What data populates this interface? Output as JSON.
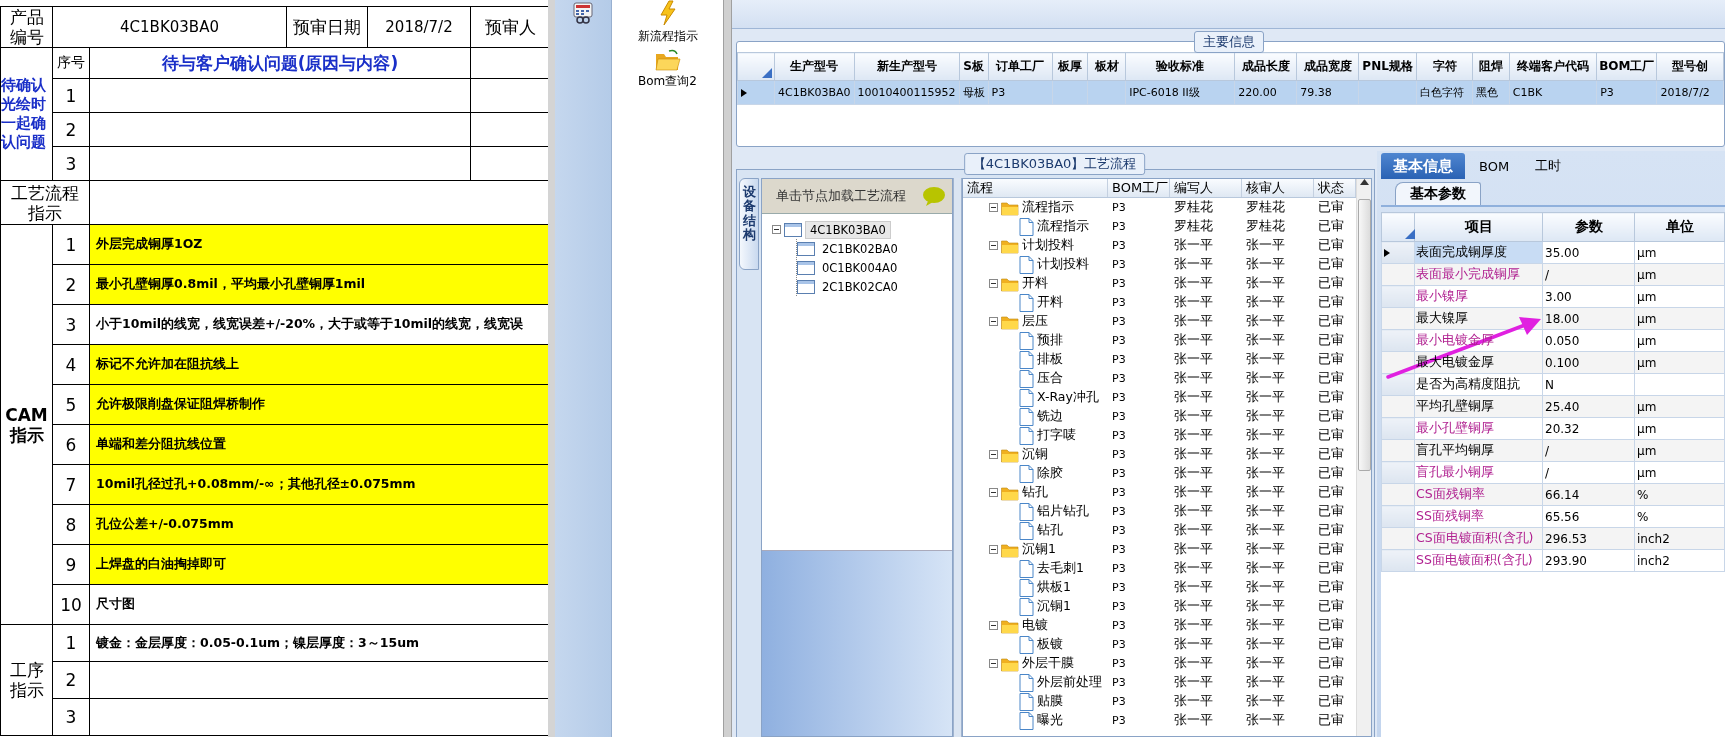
{
  "document": {
    "header": {
      "product_label": "产品编号",
      "product_no": "4C1BK03BA0",
      "date_label": "预审日期",
      "date": "2018/7/2",
      "reviewer_label": "预审人"
    },
    "confirm": {
      "label": "待确认光绘时一起确认问题",
      "seq_header": "序号",
      "question_header": "待与客户确认问题(原因与内容)",
      "rows": [
        "1",
        "2",
        "3"
      ]
    },
    "flow": {
      "label": "工艺流程指示"
    },
    "cam": {
      "label": "CAM指示",
      "rows": [
        {
          "no": "1",
          "text": "外层完成铜厚1OZ",
          "highlighted": true
        },
        {
          "no": "2",
          "text": "最小孔壁铜厚0.8mil，平均最小孔壁铜厚1mil",
          "highlighted": true
        },
        {
          "no": "3",
          "text": "小于10mil的线宽，线宽误差+/-20%，大于或等于10mil的线宽，线宽误",
          "highlighted": false
        },
        {
          "no": "4",
          "text": "标记不允许加在阻抗线上",
          "highlighted": true
        },
        {
          "no": "5",
          "text": "允许极限削盘保证阻焊桥制作",
          "highlighted": true
        },
        {
          "no": "6",
          "text": "单端和差分阻抗线位置",
          "highlighted": true
        },
        {
          "no": "7",
          "text": "10mil孔径过孔+0.08mm/-∞；其他孔径±0.075mm",
          "highlighted": true
        },
        {
          "no": "8",
          "text": "孔位公差+/-0.075mm",
          "highlighted": true
        },
        {
          "no": "9",
          "text": "上焊盘的白油掏掉即可",
          "highlighted": true
        },
        {
          "no": "10",
          "text": "尺寸图",
          "highlighted": false
        }
      ]
    },
    "process": {
      "label": "工序指示",
      "rows": [
        {
          "no": "1",
          "text": "镀金：金层厚度：0.05-0.1um；镍层厚度：3～15um"
        },
        {
          "no": "2"
        },
        {
          "no": "3"
        }
      ]
    }
  },
  "toolbar": {
    "buttons": [
      {
        "label": "新流程指示",
        "kind": "lightning"
      },
      {
        "label": "Bom查询2",
        "kind": "folder"
      }
    ]
  },
  "main_info": {
    "title": "主要信息",
    "columns": [
      "生产型号",
      "新生产型号",
      "S板",
      "订单工厂",
      "板厚",
      "板材",
      "验收标准",
      "成品长度",
      "成品宽度",
      "PNL规格",
      "字符",
      "阻焊",
      "终端客户代码",
      "BOM工厂",
      "型号创"
    ],
    "rows": [
      {
        "selected": true,
        "cells": [
          "4C1BK03BA0",
          "10010400115952",
          "母板",
          "P3",
          null,
          null,
          "IPC-6018 II级",
          "220.00",
          "79.38",
          null,
          "白色字符",
          "黑色",
          "C1BK",
          "P3",
          "2018/7/2"
        ]
      }
    ]
  },
  "process_flow": {
    "title": "【4C1BK03BA0】工艺流程",
    "side_tab": "设备结构",
    "tree_hint": "单击节点加载工艺流程",
    "tree": [
      {
        "name": "4C1BK03BA0",
        "selected": true,
        "children": [
          {
            "name": "2C1BK02BA0",
            "selected": false
          },
          {
            "name": "0C1BK004A0",
            "selected": false
          },
          {
            "name": "2C1BK02CA0",
            "selected": false
          }
        ]
      }
    ],
    "columns": [
      "流程",
      "BOM工厂",
      "编写人",
      "核审人",
      "状态"
    ],
    "steps": [
      {
        "name": "流程指示",
        "bom_factory": "P3",
        "writer": "罗桂花",
        "reviewer": "罗桂花",
        "status": "已审",
        "children": [
          {
            "name": "流程指示",
            "bom_factory": "P3",
            "writer": "罗桂花",
            "reviewer": "罗桂花",
            "status": "已审"
          }
        ]
      },
      {
        "name": "计划投料",
        "bom_factory": "P3",
        "writer": "张一平",
        "reviewer": "张一平",
        "status": "已审",
        "children": [
          {
            "name": "计划投料",
            "bom_factory": "P3",
            "writer": "张一平",
            "reviewer": "张一平",
            "status": "已审"
          }
        ]
      },
      {
        "name": "开料",
        "bom_factory": "P3",
        "writer": "张一平",
        "reviewer": "张一平",
        "status": "已审",
        "children": [
          {
            "name": "开料",
            "bom_factory": "P3",
            "writer": "张一平",
            "reviewer": "张一平",
            "status": "已审"
          }
        ]
      },
      {
        "name": "层压",
        "bom_factory": "P3",
        "writer": "张一平",
        "reviewer": "张一平",
        "status": "已审",
        "children": [
          {
            "name": "预排",
            "bom_factory": "P3",
            "writer": "张一平",
            "reviewer": "张一平",
            "status": "已审"
          },
          {
            "name": "排板",
            "bom_factory": "P3",
            "writer": "张一平",
            "reviewer": "张一平",
            "status": "已审"
          },
          {
            "name": "压合",
            "bom_factory": "P3",
            "writer": "张一平",
            "reviewer": "张一平",
            "status": "已审"
          },
          {
            "name": "X-Ray冲孔",
            "bom_factory": "P3",
            "writer": "张一平",
            "reviewer": "张一平",
            "status": "已审"
          },
          {
            "name": "铣边",
            "bom_factory": "P3",
            "writer": "张一平",
            "reviewer": "张一平",
            "status": "已审"
          },
          {
            "name": "打字唛",
            "bom_factory": "P3",
            "writer": "张一平",
            "reviewer": "张一平",
            "status": "已审"
          }
        ]
      },
      {
        "name": "沉铜",
        "bom_factory": "P3",
        "writer": "张一平",
        "reviewer": "张一平",
        "status": "已审",
        "children": [
          {
            "name": "除胶",
            "bom_factory": "P3",
            "writer": "张一平",
            "reviewer": "张一平",
            "status": "已审"
          }
        ]
      },
      {
        "name": "钻孔",
        "bom_factory": "P3",
        "writer": "张一平",
        "reviewer": "张一平",
        "status": "已审",
        "children": [
          {
            "name": "铝片钻孔",
            "bom_factory": "P3",
            "writer": "张一平",
            "reviewer": "张一平",
            "status": "已审"
          },
          {
            "name": "钻孔",
            "bom_factory": "P3",
            "writer": "张一平",
            "reviewer": "张一平",
            "status": "已审"
          }
        ]
      },
      {
        "name": "沉铜1",
        "bom_factory": "P3",
        "writer": "张一平",
        "reviewer": "张一平",
        "status": "已审",
        "children": [
          {
            "name": "去毛刺1",
            "bom_factory": "P3",
            "writer": "张一平",
            "reviewer": "张一平",
            "status": "已审"
          },
          {
            "name": "烘板1",
            "bom_factory": "P3",
            "writer": "张一平",
            "reviewer": "张一平",
            "status": "已审"
          },
          {
            "name": "沉铜1",
            "bom_factory": "P3",
            "writer": "张一平",
            "reviewer": "张一平",
            "status": "已审"
          }
        ]
      },
      {
        "name": "电镀",
        "bom_factory": "P3",
        "writer": "张一平",
        "reviewer": "张一平",
        "status": "已审",
        "children": [
          {
            "name": "板镀",
            "bom_factory": "P3",
            "writer": "张一平",
            "reviewer": "张一平",
            "status": "已审"
          }
        ]
      },
      {
        "name": "外层干膜",
        "bom_factory": "P3",
        "writer": "张一平",
        "reviewer": "张一平",
        "status": "已审",
        "children": [
          {
            "name": "外层前处理",
            "bom_factory": "P3",
            "writer": "张一平",
            "reviewer": "张一平",
            "status": "已审"
          },
          {
            "name": "贴膜",
            "bom_factory": "P3",
            "writer": "张一平",
            "reviewer": "张一平",
            "status": "已审"
          },
          {
            "name": "曝光",
            "bom_factory": "P3",
            "writer": "张一平",
            "reviewer": "张一平",
            "status": "已审"
          }
        ]
      }
    ]
  },
  "detail": {
    "tabs": [
      {
        "label": "基本信息",
        "selected": true
      },
      {
        "label": "BOM",
        "selected": false
      },
      {
        "label": "工时",
        "selected": false
      }
    ],
    "sub_tabs": [
      {
        "label": "基本参数",
        "selected": true
      }
    ],
    "columns": [
      "项目",
      "参数",
      "单位"
    ],
    "params": [
      {
        "item": "表面完成铜厚度",
        "value": "35.00",
        "unit": "μm",
        "highlighted": false,
        "selected": true
      },
      {
        "item": "表面最小完成铜厚",
        "value": "/",
        "unit": "μm",
        "highlighted": true,
        "selected": false
      },
      {
        "item": "最小镍厚",
        "value": "3.00",
        "unit": "μm",
        "highlighted": true,
        "selected": false
      },
      {
        "item": "最大镍厚",
        "value": "18.00",
        "unit": "μm",
        "highlighted": false,
        "selected": false
      },
      {
        "item": "最小电镀金厚",
        "value": "0.050",
        "unit": "μm",
        "highlighted": true,
        "selected": false
      },
      {
        "item": "最大电镀金厚",
        "value": "0.100",
        "unit": "μm",
        "highlighted": false,
        "selected": false
      },
      {
        "item": "是否为高精度阻抗",
        "value": "N",
        "highlighted": false,
        "selected": false
      },
      {
        "item": "平均孔壁铜厚",
        "value": "25.40",
        "unit": "μm",
        "highlighted": false,
        "selected": false
      },
      {
        "item": "最小孔壁铜厚",
        "value": "20.32",
        "unit": "μm",
        "highlighted": true,
        "selected": false
      },
      {
        "item": "盲孔平均铜厚",
        "value": "/",
        "unit": "μm",
        "highlighted": false,
        "selected": false
      },
      {
        "item": "盲孔最小铜厚",
        "value": "/",
        "unit": "μm",
        "highlighted": true,
        "selected": false
      },
      {
        "item": "CS面残铜率",
        "value": "66.14",
        "unit": "%",
        "highlighted": true,
        "selected": false
      },
      {
        "item": "SS面残铜率",
        "value": "65.56",
        "unit": "%",
        "highlighted": true,
        "selected": false
      },
      {
        "item": "CS面电镀面积(含孔)",
        "value": "296.53",
        "unit": "inch2",
        "highlighted": true,
        "selected": false
      },
      {
        "item": "SS面电镀面积(含孔)",
        "value": "293.90",
        "unit": "inch2",
        "highlighted": true,
        "selected": false
      }
    ]
  }
}
